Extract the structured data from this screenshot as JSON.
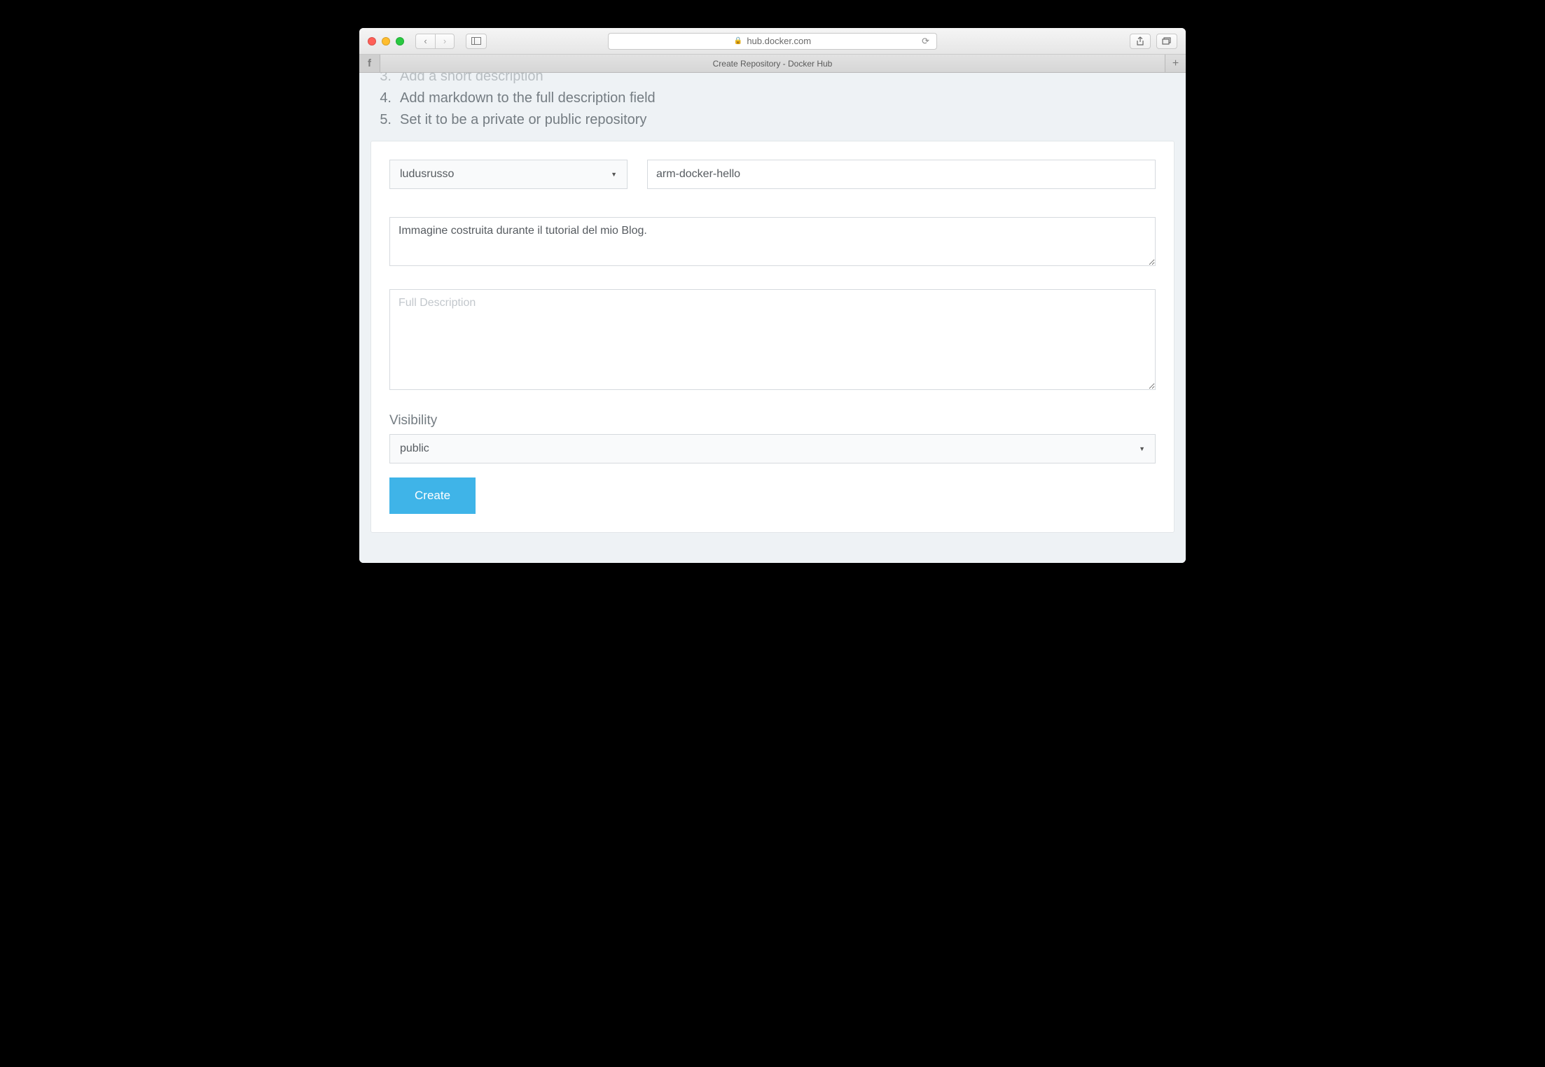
{
  "browser": {
    "url_host": "hub.docker.com",
    "tab_title": "Create Repository - Docker Hub"
  },
  "steps": {
    "s3": "Add a short description",
    "s4": "Add markdown to the full description field",
    "s5": "Set it to be a private or public repository"
  },
  "form": {
    "namespace": "ludusrusso",
    "repo_name": "arm-docker-hello",
    "short_desc": "Immagine costruita durante il tutorial del mio Blog.",
    "full_desc_placeholder": "Full Description",
    "visibility_label": "Visibility",
    "visibility_value": "public",
    "create_label": "Create"
  }
}
